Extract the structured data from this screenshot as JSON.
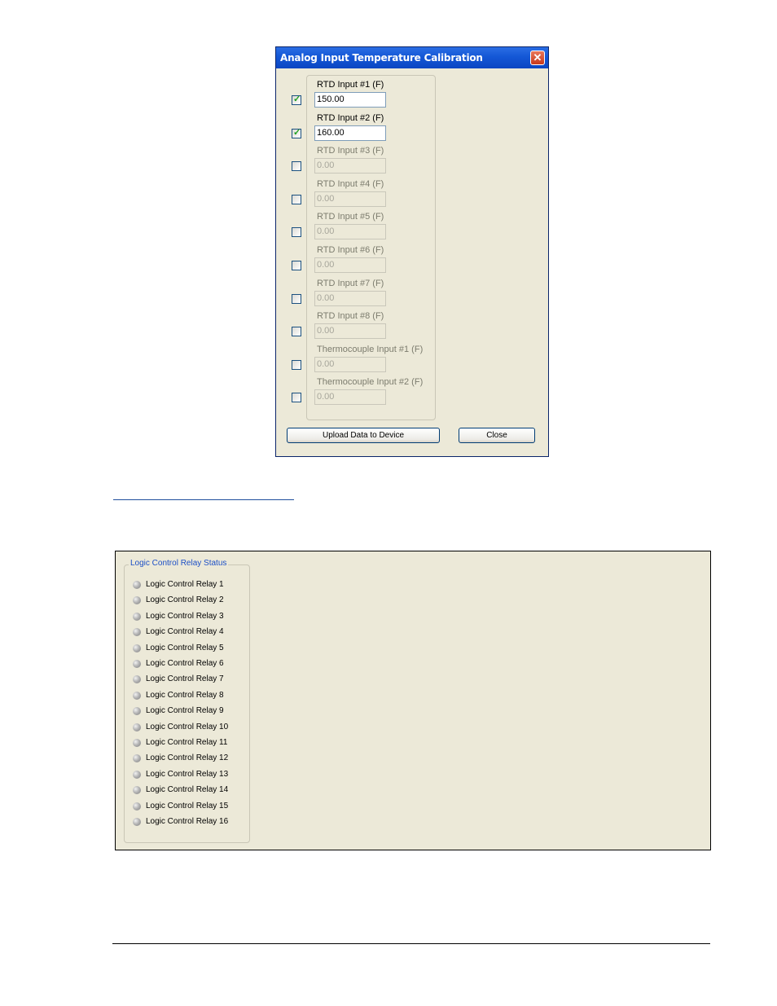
{
  "dialog": {
    "title": "Analog Input Temperature Calibration",
    "close_glyph": "✕",
    "rows": [
      {
        "label": "RTD Input #1 (F)",
        "value": "150.00",
        "checked": true
      },
      {
        "label": "RTD Input #2 (F)",
        "value": "160.00",
        "checked": true
      },
      {
        "label": "RTD Input #3 (F)",
        "value": "0.00",
        "checked": false
      },
      {
        "label": "RTD Input #4 (F)",
        "value": "0.00",
        "checked": false
      },
      {
        "label": "RTD Input #5 (F)",
        "value": "0.00",
        "checked": false
      },
      {
        "label": "RTD Input #6 (F)",
        "value": "0.00",
        "checked": false
      },
      {
        "label": "RTD Input #7 (F)",
        "value": "0.00",
        "checked": false
      },
      {
        "label": "RTD Input #8 (F)",
        "value": "0.00",
        "checked": false
      },
      {
        "label": "Thermocouple Input #1 (F)",
        "value": "0.00",
        "checked": false
      },
      {
        "label": "Thermocouple Input #2 (F)",
        "value": "0.00",
        "checked": false
      }
    ],
    "upload_label": "Upload Data to Device",
    "close_label": "Close"
  },
  "relay_status": {
    "title": "Logic Control Relay Status",
    "items": [
      "Logic Control Relay 1",
      "Logic Control Relay 2",
      "Logic Control Relay 3",
      "Logic Control Relay 4",
      "Logic Control Relay 5",
      "Logic Control Relay 6",
      "Logic Control Relay 7",
      "Logic Control Relay 8",
      "Logic Control Relay 9",
      "Logic Control Relay 10",
      "Logic Control Relay 11",
      "Logic Control Relay 12",
      "Logic Control Relay 13",
      "Logic Control Relay 14",
      "Logic Control Relay 15",
      "Logic Control Relay 16"
    ]
  }
}
